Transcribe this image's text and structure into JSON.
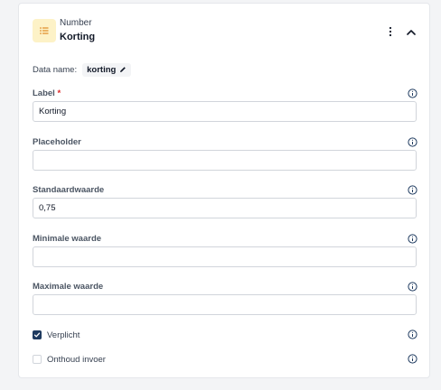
{
  "header": {
    "type_label": "Number",
    "field_title": "Korting"
  },
  "dataname": {
    "label": "Data name:",
    "value": "korting"
  },
  "fields": {
    "label": {
      "label": "Label",
      "required_mark": "*",
      "value": "Korting"
    },
    "placeholder": {
      "label": "Placeholder",
      "value": ""
    },
    "default": {
      "label": "Standaardwaarde",
      "value": "0,75"
    },
    "min": {
      "label": "Minimale waarde",
      "value": ""
    },
    "max": {
      "label": "Maximale waarde",
      "value": ""
    }
  },
  "checkboxes": {
    "required": {
      "label": "Verplicht",
      "checked": true
    },
    "remember": {
      "label": "Onthoud invoer",
      "checked": false
    }
  },
  "icons": {
    "type": "list-icon",
    "menu": "kebab-menu-icon",
    "collapse": "chevron-up-icon",
    "edit": "pencil-icon",
    "info": "info-icon",
    "check": "check-icon"
  },
  "colors": {
    "accent": "#1e3a5f",
    "type_badge_bg": "#fdf2c7",
    "required": "#dc2626"
  }
}
